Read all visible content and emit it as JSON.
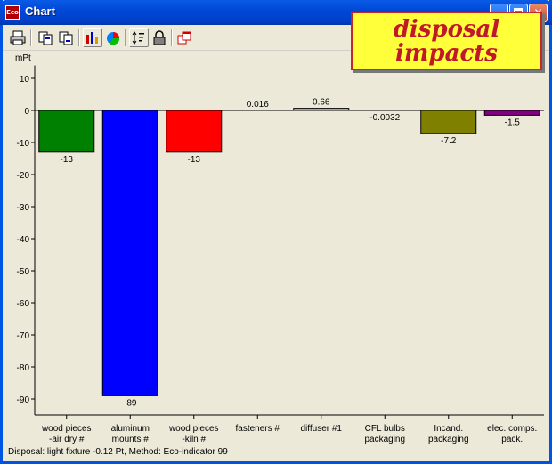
{
  "window": {
    "title": "Chart",
    "app_icon": "Eco",
    "controls": [
      "minimize-icon",
      "maximize-icon",
      "close-icon"
    ],
    "accent": "#0054e3"
  },
  "toolbar": {
    "buttons": [
      {
        "name": "print-button",
        "icon": "printer-icon"
      },
      {
        "name": "copy-button",
        "icon": "copy-icon"
      },
      {
        "name": "copy-data-button",
        "icon": "copy-data-icon"
      },
      {
        "name": "bar-chart-button",
        "icon": "bar-chart-icon",
        "pressed": true
      },
      {
        "name": "pie-chart-button",
        "icon": "pie-chart-icon"
      },
      {
        "name": "sort-button",
        "icon": "sort-icon",
        "pressed": true
      },
      {
        "name": "lock-button",
        "icon": "lock-icon"
      },
      {
        "name": "window-button",
        "icon": "window-icon"
      }
    ]
  },
  "annotation": {
    "line1": "disposal",
    "line2": "impacts",
    "background": "#ffff3a",
    "text_color": "#c0182a"
  },
  "chart_data": {
    "type": "bar",
    "ylabel": "mPt",
    "ylim": [
      -95,
      14
    ],
    "yticks": [
      10,
      0,
      -10,
      -20,
      -30,
      -40,
      -50,
      -60,
      -70,
      -80,
      -90
    ],
    "grid": false,
    "legend": "none",
    "categories": [
      [
        "wood pieces",
        "-air dry #"
      ],
      [
        "aluminum",
        "mounts #"
      ],
      [
        "wood pieces",
        "-kiln #"
      ],
      [
        "fasteners #"
      ],
      [
        "diffuser #1"
      ],
      [
        "CFL bulbs",
        "packaging"
      ],
      [
        "Incand.",
        "packaging"
      ],
      [
        "elec. comps.",
        "pack."
      ]
    ],
    "values": [
      -13,
      -89,
      -13,
      0.016,
      0.66,
      -0.0032,
      -7.2,
      -1.5
    ],
    "value_labels": [
      "-13",
      "-89",
      "-13",
      "0.016",
      "0.66",
      "-0.0032",
      "-7.2",
      "-1.5"
    ],
    "colors": [
      "#008000",
      "#0000ff",
      "#ff0000",
      "#ffffff",
      "#c0c0c0",
      "#808080",
      "#808000",
      "#800080"
    ]
  },
  "status": {
    "text": "Disposal:  light fixture  -0.12 Pt,  Method: Eco-indicator 99"
  }
}
